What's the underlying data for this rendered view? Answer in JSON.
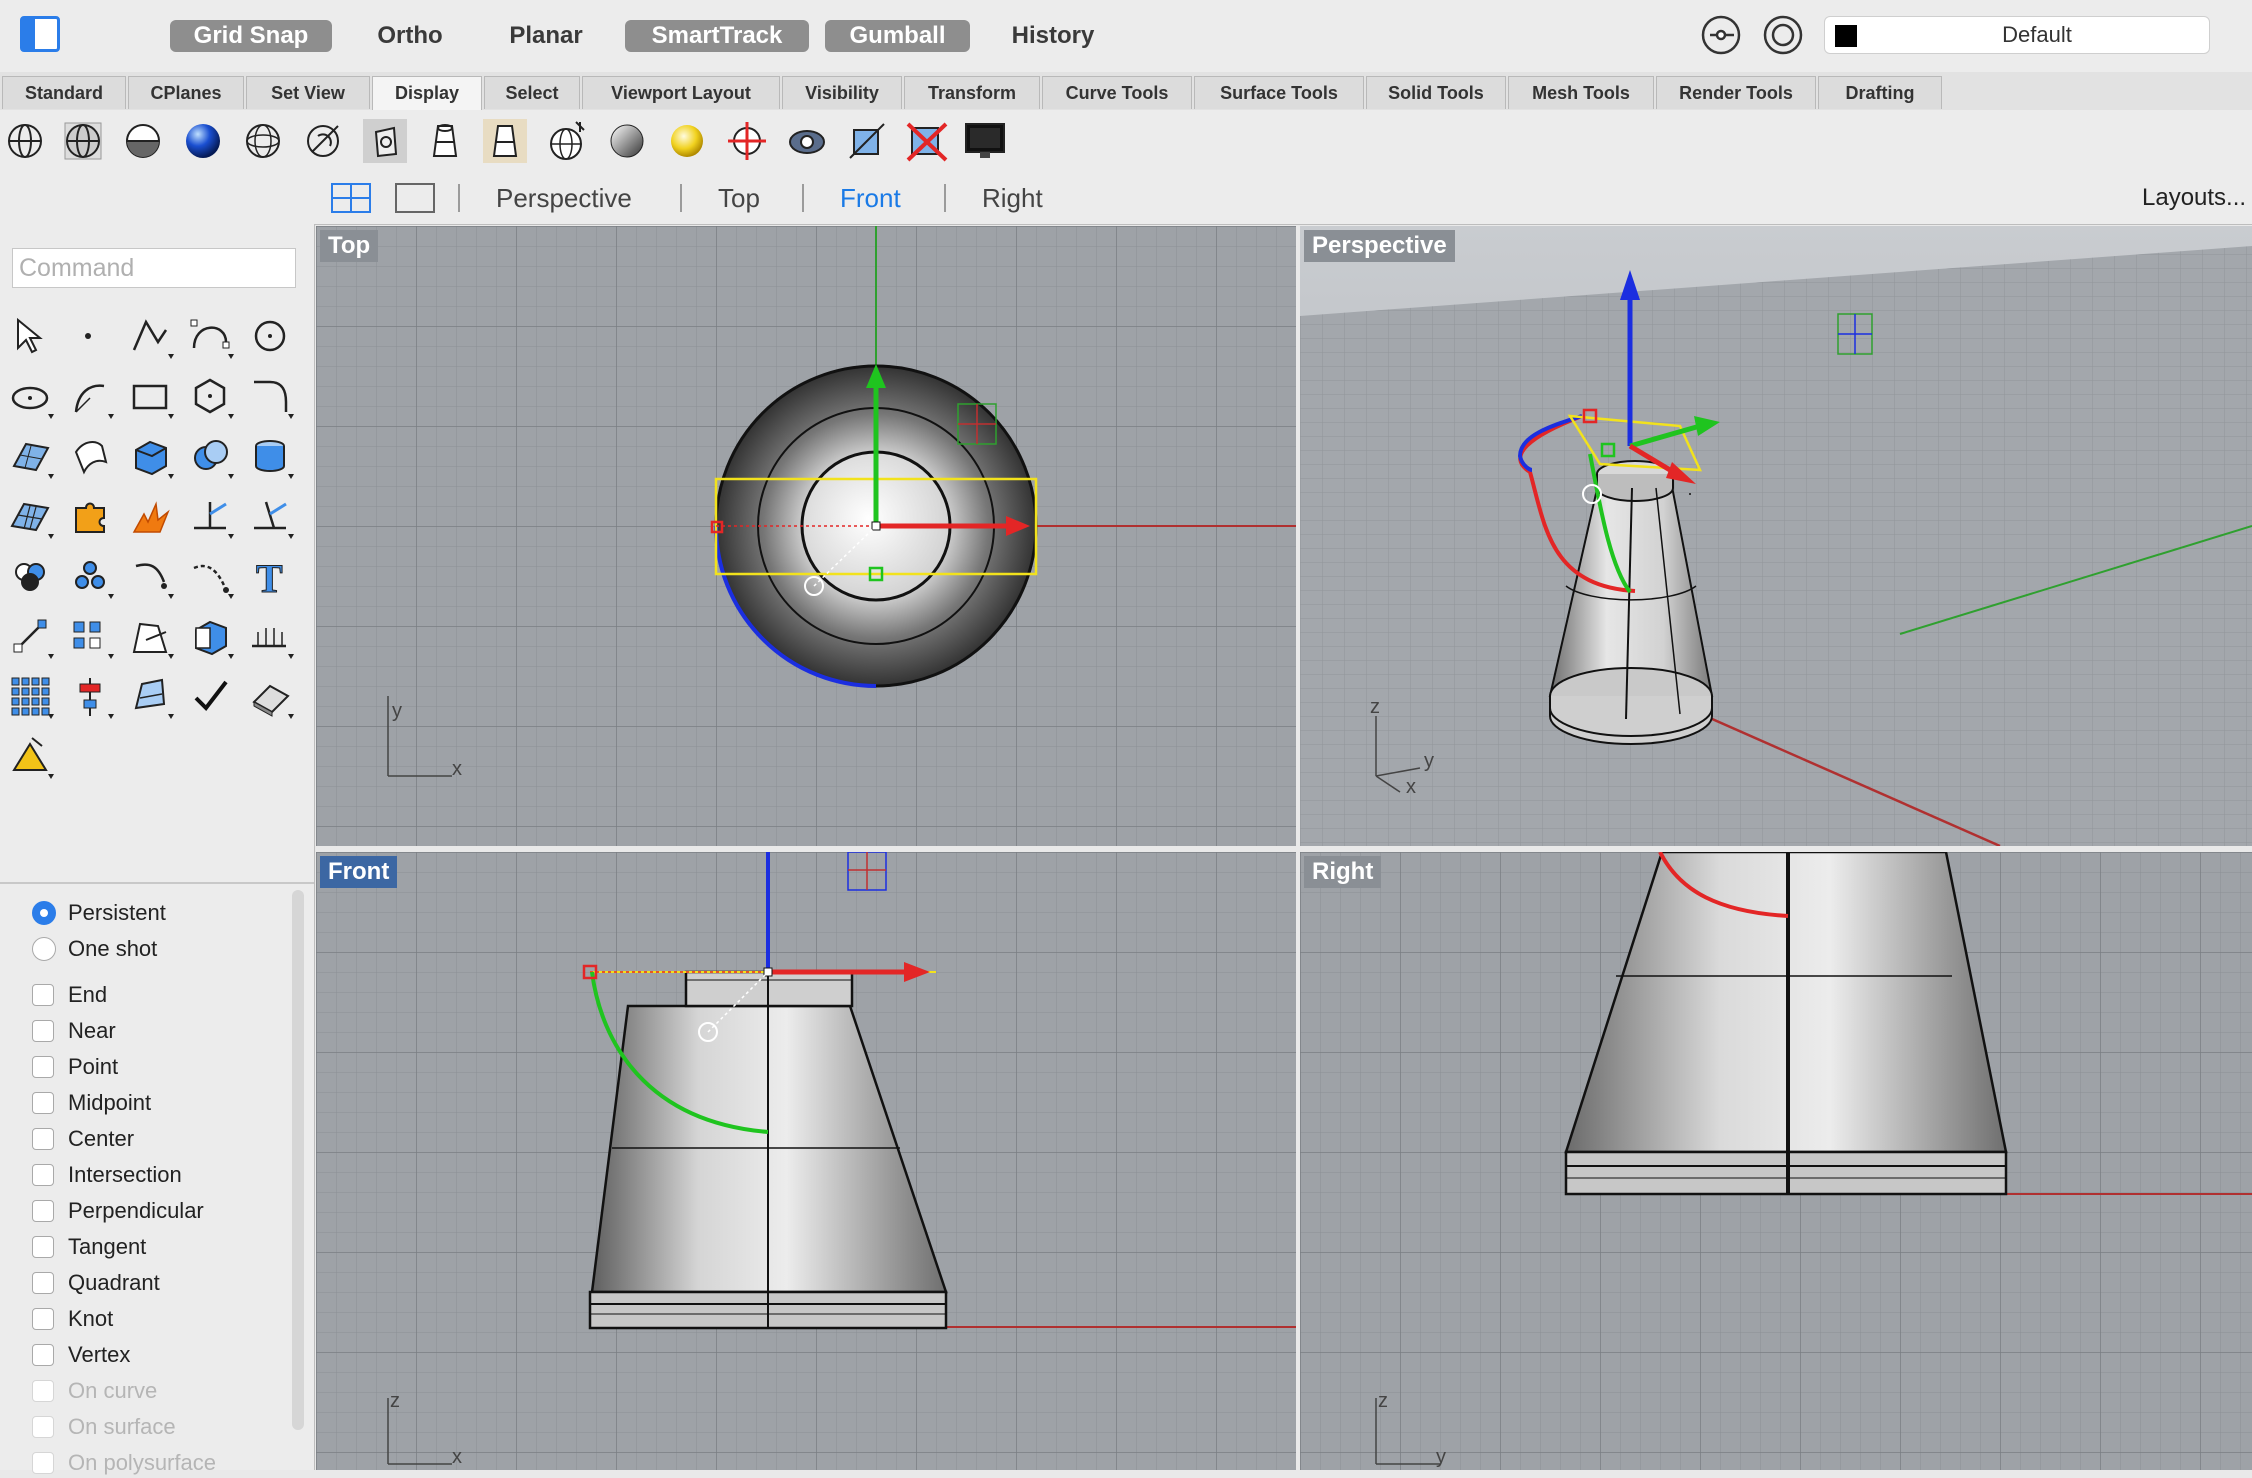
{
  "topbar": {
    "modes": [
      {
        "label": "Grid Snap",
        "on": true
      },
      {
        "label": "Ortho",
        "on": false
      },
      {
        "label": "Planar",
        "on": false
      },
      {
        "label": "SmartTrack",
        "on": true
      },
      {
        "label": "Gumball",
        "on": true
      },
      {
        "label": "History",
        "on": false
      }
    ],
    "layer": "Default",
    "icons": [
      "sidebar-toggle-icon",
      "osnap-icon",
      "record-history-icon"
    ]
  },
  "tabs": [
    "Standard",
    "CPlanes",
    "Set View",
    "Display",
    "Select",
    "Viewport Layout",
    "Visibility",
    "Transform",
    "Curve Tools",
    "Surface Tools",
    "Solid Tools",
    "Mesh Tools",
    "Render Tools",
    "Drafting"
  ],
  "active_tab": "Display",
  "display_icons": [
    "wireframe-icon",
    "shaded-icon",
    "rendered-icon",
    "ghosted-icon",
    "xray-icon",
    "technical-icon",
    "pen-icon",
    "artistic-icon",
    "arctic-icon",
    "raytraced-icon",
    "monochrome-icon",
    "light-icon",
    "camera-target-icon",
    "zoom-icon",
    "mesh-icon",
    "hide-icon",
    "capture-viewport-icon"
  ],
  "viewport_tabs": {
    "items": [
      "Perspective",
      "Top",
      "Front",
      "Right"
    ],
    "active": "Front",
    "layouts": "Layouts..."
  },
  "command": {
    "placeholder": "Command"
  },
  "tool_icons": [
    "select-icon",
    "point-icon",
    "polyline-icon",
    "curve-icon",
    "circle-icon",
    "ellipse-icon",
    "arc-icon",
    "rectangle-icon",
    "polygon-icon",
    "fillet-icon",
    "surface-icon",
    "surface-from-curves-icon",
    "box-icon",
    "solid-union-icon",
    "extrude-icon",
    "mesh-icon",
    "explode-icon",
    "boolean-icon",
    "trim-icon",
    "split-icon",
    "group-icon",
    "point-cloud-icon",
    "offset-icon",
    "arc-blend-icon",
    "text-icon",
    "move-icon",
    "array-icon",
    "drafting-icon",
    "solid-edit-icon",
    "dimension-icon",
    "grid-array-icon",
    "align-icon",
    "analyze-icon",
    "check-icon",
    "render-icon",
    "light-settings-icon"
  ],
  "osnaps": {
    "modes": [
      {
        "label": "Persistent",
        "checked": true
      },
      {
        "label": "One shot",
        "checked": false
      }
    ],
    "items": [
      {
        "label": "End",
        "enabled": true
      },
      {
        "label": "Near",
        "enabled": true
      },
      {
        "label": "Point",
        "enabled": true
      },
      {
        "label": "Midpoint",
        "enabled": true
      },
      {
        "label": "Center",
        "enabled": true
      },
      {
        "label": "Intersection",
        "enabled": true
      },
      {
        "label": "Perpendicular",
        "enabled": true
      },
      {
        "label": "Tangent",
        "enabled": true
      },
      {
        "label": "Quadrant",
        "enabled": true
      },
      {
        "label": "Knot",
        "enabled": true
      },
      {
        "label": "Vertex",
        "enabled": true
      },
      {
        "label": "On curve",
        "enabled": false
      },
      {
        "label": "On surface",
        "enabled": false
      },
      {
        "label": "On polysurface",
        "enabled": false
      }
    ]
  },
  "viewports": {
    "top": {
      "title": "Top",
      "axes": [
        "x",
        "y"
      ]
    },
    "perspective": {
      "title": "Perspective",
      "axes": [
        "x",
        "y",
        "z"
      ]
    },
    "front": {
      "title": "Front",
      "axes": [
        "x",
        "z"
      ]
    },
    "right": {
      "title": "Right",
      "axes": [
        "y",
        "z"
      ]
    }
  },
  "colors": {
    "accent": "#2b7de9",
    "active_viewport": "#3c67a3",
    "x_axis": "#e32626",
    "y_axis": "#1fc41f",
    "z_axis": "#1b2ee0",
    "selection": "#f2e21c"
  }
}
